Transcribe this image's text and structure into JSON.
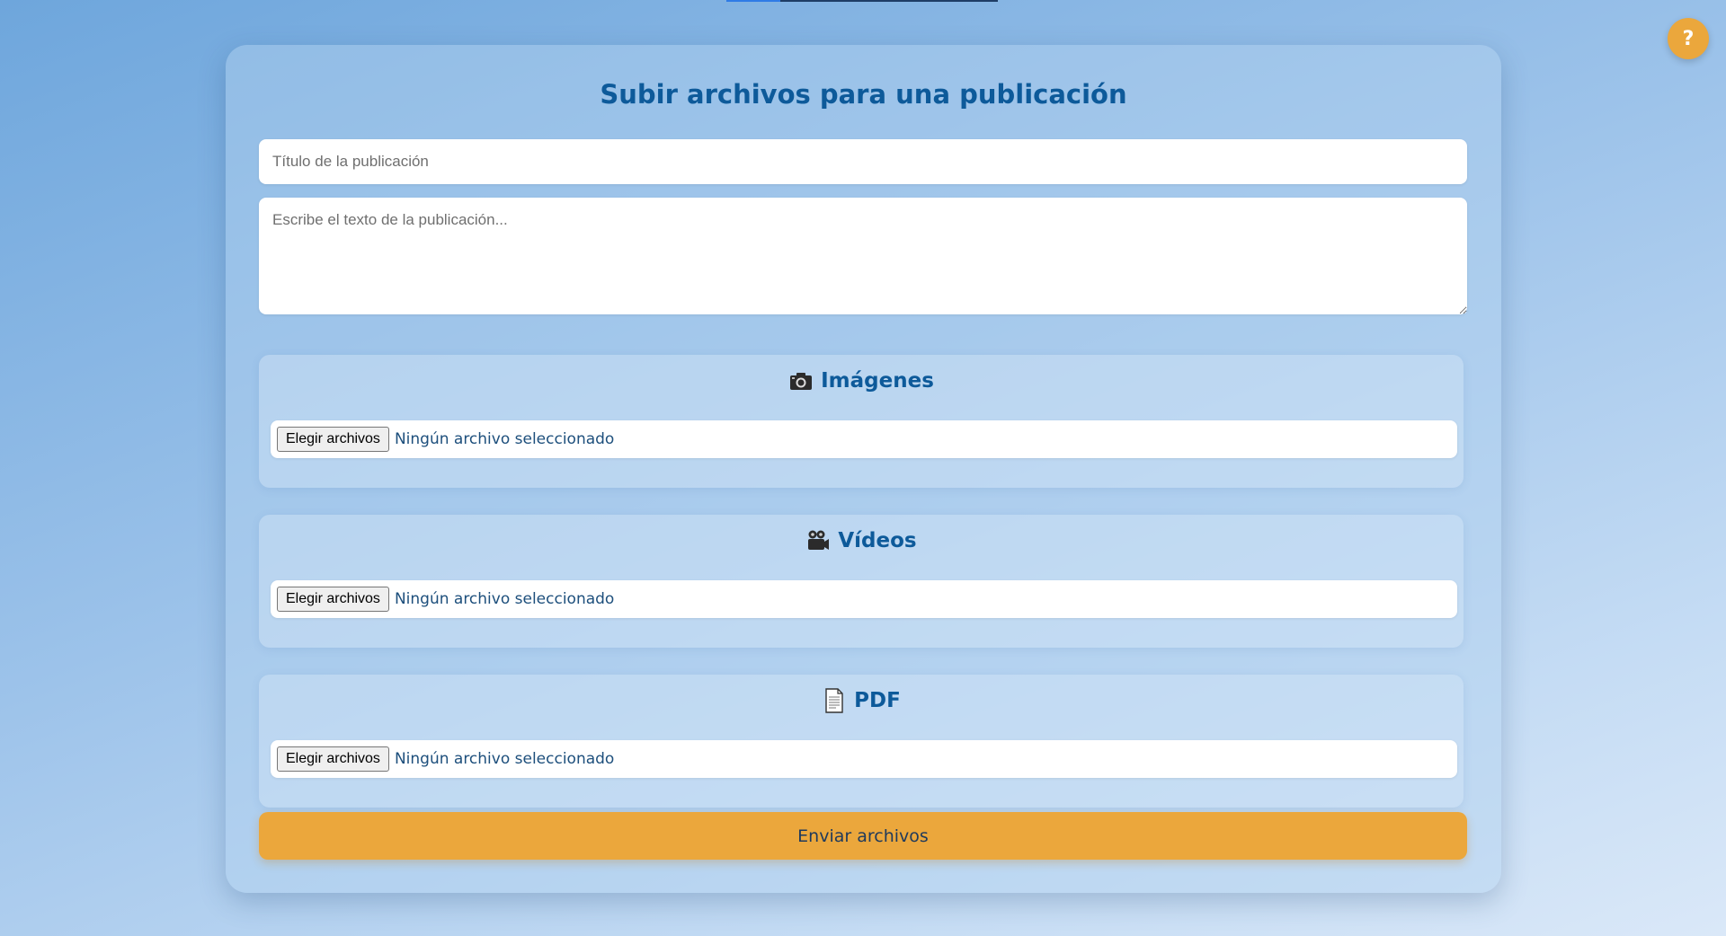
{
  "page": {
    "title": "Subir archivos para una publicación"
  },
  "help": {
    "label": "?"
  },
  "form": {
    "title_placeholder": "Título de la publicación",
    "title_value": "",
    "body_placeholder": "Escribe el texto de la publicación...",
    "body_value": ""
  },
  "sections": [
    {
      "icon": "camera-icon",
      "heading": "Imágenes",
      "button_label": "Elegir archivos",
      "status": "Ningún archivo seleccionado"
    },
    {
      "icon": "video-camera-icon",
      "heading": "Vídeos",
      "button_label": "Elegir archivos",
      "status": "Ningún archivo seleccionado"
    },
    {
      "icon": "document-icon",
      "heading": "PDF",
      "button_label": "Elegir archivos",
      "status": "Ningún archivo seleccionado"
    }
  ],
  "submit": {
    "label": "Enviar archivos"
  },
  "colors": {
    "accent": "#eba73c",
    "heading": "#0d5a9a",
    "status_text": "#1d4f7c"
  }
}
